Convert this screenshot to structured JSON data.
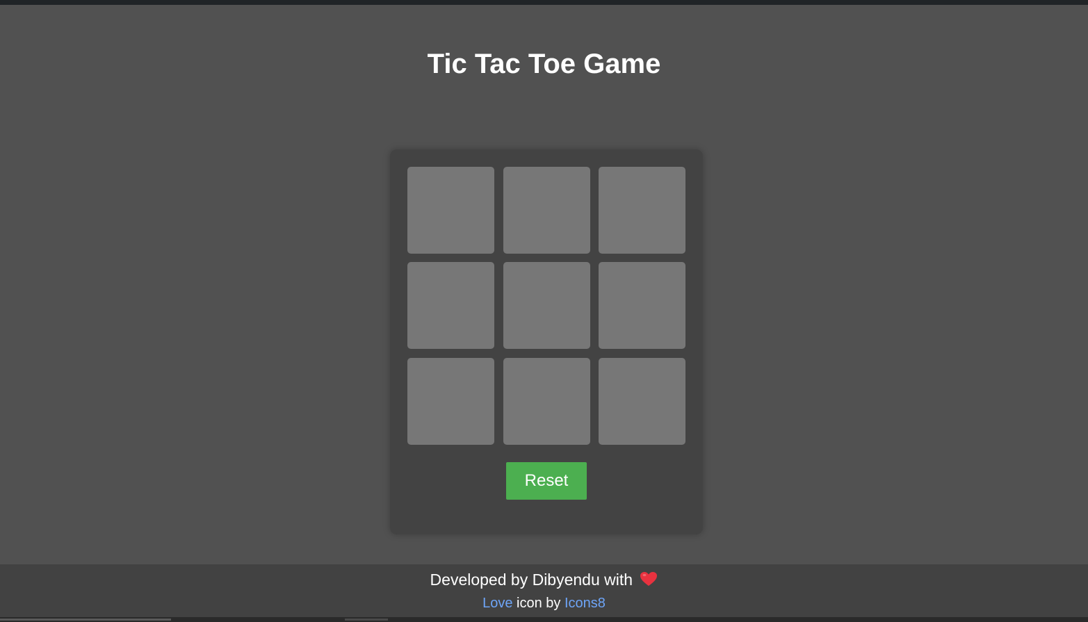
{
  "page": {
    "title": "Tic Tac Toe Game"
  },
  "board": {
    "cells": [
      "",
      "",
      "",
      "",
      "",
      "",
      "",
      "",
      ""
    ],
    "reset_label": "Reset"
  },
  "footer": {
    "credit_text": "Developed by Dibyendu with",
    "heart_icon": "heart-icon",
    "love_link": "Love",
    "icon_by_text": "icon by",
    "icons8_link": "Icons8"
  },
  "colors": {
    "background": "#515151",
    "board": "#434343",
    "cell": "#777777",
    "reset_button": "#4caf50",
    "footer": "#424242",
    "link": "#6ea5f8",
    "heart": "#e8323f"
  }
}
